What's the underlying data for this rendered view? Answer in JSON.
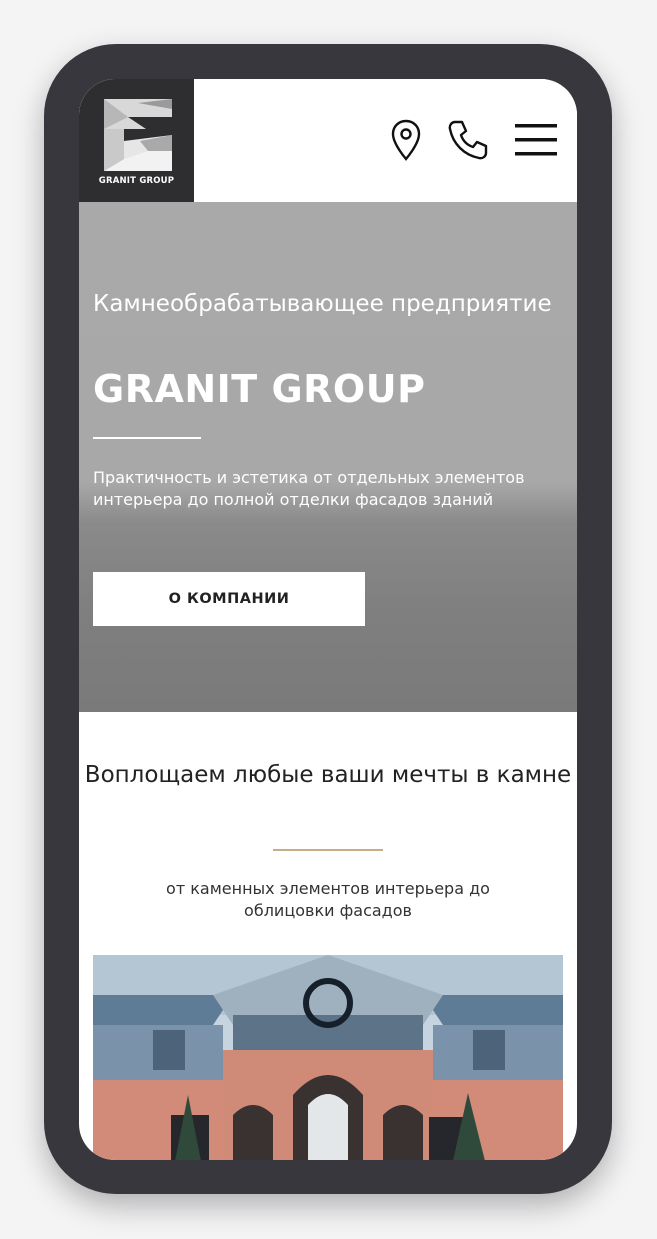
{
  "header": {
    "logo_text": "GRANIT GROUP",
    "icons": [
      "location-pin-icon",
      "phone-icon",
      "hamburger-menu-icon"
    ]
  },
  "hero": {
    "subtitle": "Камнеобрабатывающее предприятие",
    "title": "GRANIT GROUP",
    "description": "Практичность и эстетика от отдельных элементов интерьера до полной отделки фасадов зданий",
    "button_label": "О КОМПАНИИ"
  },
  "section": {
    "title": "Воплощаем любые ваши мечты в камне",
    "subtitle": "от каменных элементов интерьера до облицовки фасадов",
    "image": "building-facade-photo"
  },
  "colors": {
    "frame": "#38373d",
    "logo_bg": "#2e2e31",
    "accent": "#c8ad8a",
    "hero_bg": "#a8a8a8"
  }
}
